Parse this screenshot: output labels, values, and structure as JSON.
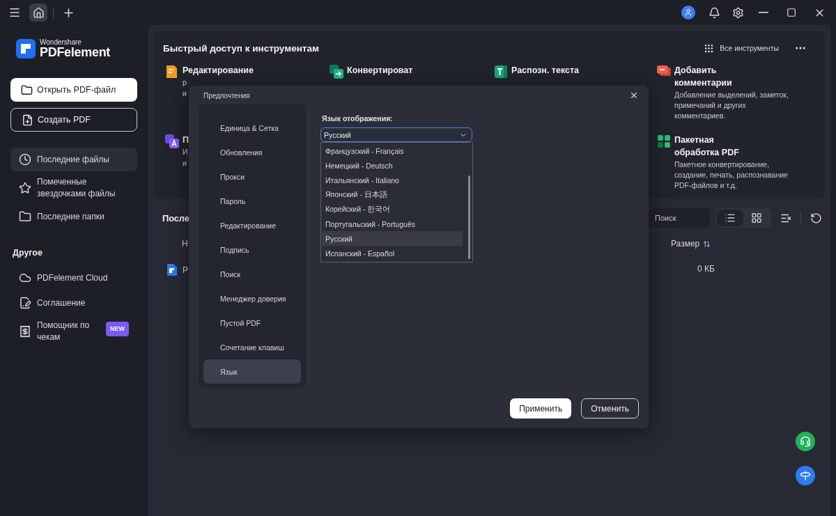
{
  "sidebar": {
    "logo": {
      "brand": "Wondershare",
      "product": "PDFelement"
    },
    "actions": [
      {
        "kind": "primary",
        "label": "Открыть PDF-файл"
      },
      {
        "kind": "outline",
        "label": "Создать PDF"
      }
    ],
    "nav": [
      {
        "label": "Последние файлы",
        "selected": true
      },
      {
        "label": "Помеченные звездочками файлы",
        "selected": false
      },
      {
        "label": "Последние папки",
        "selected": false
      }
    ],
    "section_title": "Другое",
    "other": [
      {
        "label": "PDFelement Cloud"
      },
      {
        "label": "Соглашение"
      },
      {
        "label": "Помощник по чекам",
        "badge": "NEW"
      }
    ]
  },
  "quick_access": {
    "title": "Быстрый доступ к инструментам",
    "all_tools": "Все инструменты",
    "tools": [
      {
        "title": "Редактирование",
        "description": [
          "р",
          "и"
        ]
      },
      {
        "title": "Конвертироват"
      },
      {
        "title": "Распозн. текста"
      },
      {
        "title": "Добавить комментарии",
        "description": [
          "Добавление выделений, заметок, примечаний и других комментариев."
        ]
      },
      {
        "title": "П",
        "description": [
          "И",
          "и"
        ]
      },
      {
        "title": "Пакетная обработка PDF",
        "description": [
          "Пакетное конвертирование, создание, печать, распознавание PDF-файлов и т.д."
        ]
      }
    ]
  },
  "recent": {
    "title": "После",
    "search": {
      "placeholder": "Поиск"
    },
    "view_modes": [
      {
        "selected": true
      },
      {
        "selected": false
      }
    ],
    "columns": [
      {
        "label": "Н"
      },
      {
        "label": "Размер",
        "sortable": true
      }
    ],
    "rows": [
      {
        "name": "Р",
        "size": "0 КБ"
      }
    ]
  },
  "dialog": {
    "title": "Предпочтения",
    "nav": [
      {
        "label": "Единица & Сетка",
        "selected": false
      },
      {
        "label": "Обновления",
        "selected": false
      },
      {
        "label": "Прокси",
        "selected": false
      },
      {
        "label": "Пароль",
        "selected": false
      },
      {
        "label": "Редактирование",
        "selected": false
      },
      {
        "label": "Подпись",
        "selected": false
      },
      {
        "label": "Поиск",
        "selected": false
      },
      {
        "label": "Менеджер доверия",
        "selected": false
      },
      {
        "label": "Пустой PDF",
        "selected": false
      },
      {
        "label": "Сочетание клавиш",
        "selected": false
      },
      {
        "label": "Язык",
        "selected": true
      }
    ],
    "field_label": "Язык отображения:",
    "select": {
      "value": "Русский",
      "expanded": true
    },
    "options": [
      {
        "label": "Французский - Français",
        "selected": false
      },
      {
        "label": "Немецкий - Deutsch",
        "selected": false
      },
      {
        "label": "Итальянский - Italiano",
        "selected": false
      },
      {
        "label": "Японский - 日本語",
        "selected": false
      },
      {
        "label": "Корейский - 한국어",
        "selected": false
      },
      {
        "label": "Португальский - Português",
        "selected": false
      },
      {
        "label": "Русский",
        "selected": true
      },
      {
        "label": "Испанский - Español",
        "selected": false
      }
    ],
    "buttons": [
      {
        "kind": "primary",
        "label": "Применить"
      },
      {
        "kind": "secondary",
        "label": "Отменить"
      }
    ]
  }
}
